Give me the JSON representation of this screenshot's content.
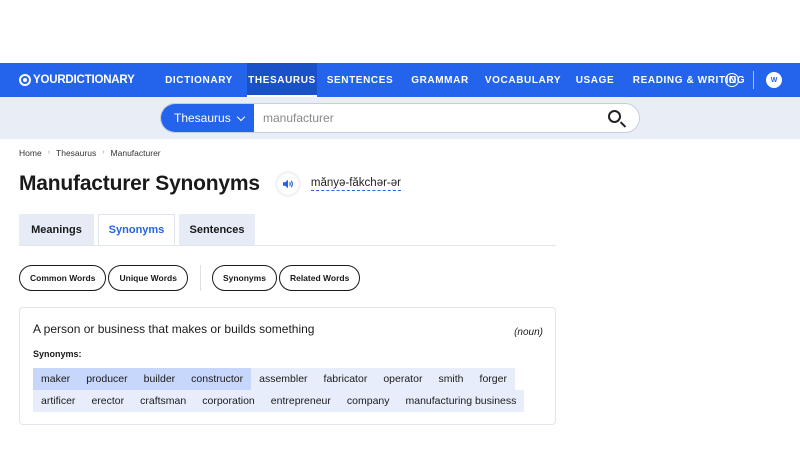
{
  "nav": {
    "logo": "YOURDICTIONARY",
    "items": [
      {
        "label": "DICTIONARY",
        "active": false
      },
      {
        "label": "THESAURUS",
        "active": true
      },
      {
        "label": "SENTENCES",
        "active": false
      },
      {
        "label": "GRAMMAR",
        "active": false
      },
      {
        "label": "VOCABULARY",
        "active": false
      },
      {
        "label": "USAGE",
        "active": false
      },
      {
        "label": "READING & WRITING",
        "active": false
      }
    ],
    "user_icon": "user-circle-icon",
    "badge_text": "W"
  },
  "search": {
    "select_value": "Thesaurus",
    "query": "manufacturer",
    "button_icon": "search-icon"
  },
  "breadcrumb": [
    "Home",
    "Thesaurus",
    "Manufacturer"
  ],
  "page": {
    "title": "Manufacturer Synonyms",
    "pronunciation": "mănyə-făkchər-ər",
    "speaker_icon": "speaker-icon"
  },
  "tabs": [
    {
      "label": "Meanings",
      "active": false
    },
    {
      "label": "Synonyms",
      "active": true
    },
    {
      "label": "Sentences",
      "active": false
    }
  ],
  "filters": {
    "group1": [
      "Common Words",
      "Unique Words"
    ],
    "group2": [
      "Synonyms",
      "Related Words"
    ]
  },
  "sense": {
    "definition": "A person or business that makes or builds something",
    "part_of_speech": "(noun)",
    "synonyms_label": "Synonyms:",
    "row1": [
      "maker",
      "producer",
      "builder",
      "constructor",
      "assembler",
      "fabricator",
      "operator",
      "smith",
      "forger"
    ],
    "row2": [
      "artificer",
      "erector",
      "craftsman",
      "corporation",
      "entrepreneur",
      "company",
      "manufacturing business"
    ]
  },
  "colors": {
    "brand": "#2463eb",
    "search_band": "#e9edf5",
    "synonym_strong": "#c7d6fb",
    "synonym_weak": "#e7edfb"
  }
}
